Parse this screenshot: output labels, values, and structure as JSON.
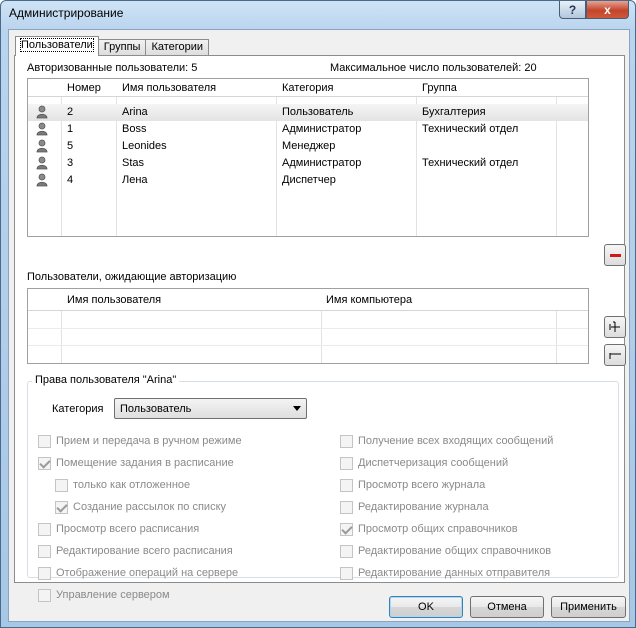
{
  "window": {
    "title": "Администрирование",
    "help": "?",
    "close": "x"
  },
  "tabs": [
    "Пользователи",
    "Группы",
    "Категории"
  ],
  "authorized": {
    "count_label": "Авторизованные пользователи: 5",
    "max_label": "Максимальное число пользователей: 20",
    "columns": [
      "Номер",
      "Имя пользователя",
      "Категория",
      "Группа"
    ],
    "rows": [
      {
        "num": "2",
        "name": "Arina",
        "cat": "Пользователь",
        "group": "Бухгалтерия",
        "selected": true
      },
      {
        "num": "1",
        "name": "Boss",
        "cat": "Администратор",
        "group": "Технический отдел"
      },
      {
        "num": "5",
        "name": "Leonides",
        "cat": "Менеджер",
        "group": ""
      },
      {
        "num": "3",
        "name": "Stas",
        "cat": "Администратор",
        "group": "Технический отдел"
      },
      {
        "num": "4",
        "name": "Лена",
        "cat": "Диспетчер",
        "group": ""
      }
    ]
  },
  "pending": {
    "label": "Пользователи, ожидающие авторизацию",
    "columns": [
      "Имя пользователя",
      "Имя компьютера"
    ]
  },
  "rights": {
    "title": "Права пользователя \"Arina\"",
    "category_label": "Категория",
    "category_value": "Пользователь",
    "left": [
      {
        "label": "Прием и передача в ручном режиме",
        "checked": false,
        "indent": 0
      },
      {
        "label": "Помещение задания в расписание",
        "checked": true,
        "indent": 0
      },
      {
        "label": "только как отложенное",
        "checked": false,
        "indent": 1
      },
      {
        "label": "Создание рассылок по списку",
        "checked": true,
        "indent": 1
      },
      {
        "label": "Просмотр всего расписания",
        "checked": false,
        "indent": 0
      },
      {
        "label": "Редактирование всего расписания",
        "checked": false,
        "indent": 0
      },
      {
        "label": "Отображение операций на сервере",
        "checked": false,
        "indent": 0
      },
      {
        "label": "Управление сервером",
        "checked": false,
        "indent": 0
      }
    ],
    "right": [
      {
        "label": "Получение всех входящих сообщений",
        "checked": false
      },
      {
        "label": "Диспетчеризация сообщений",
        "checked": false
      },
      {
        "label": "Просмотр всего журнала",
        "checked": false
      },
      {
        "label": "Редактирование журнала",
        "checked": false
      },
      {
        "label": "Просмотр общих справочников",
        "checked": true
      },
      {
        "label": "Редактирование общих справочников",
        "checked": false
      },
      {
        "label": "Редактирование данных отправителя",
        "checked": false
      }
    ]
  },
  "buttons": {
    "ok": "OK",
    "cancel": "Отмена",
    "apply": "Применить"
  },
  "colors": {
    "titlebar": "#b9d4ee",
    "close": "#c2452c",
    "remove_icon": "#d01818",
    "default_button_border": "#3c7fb1"
  }
}
